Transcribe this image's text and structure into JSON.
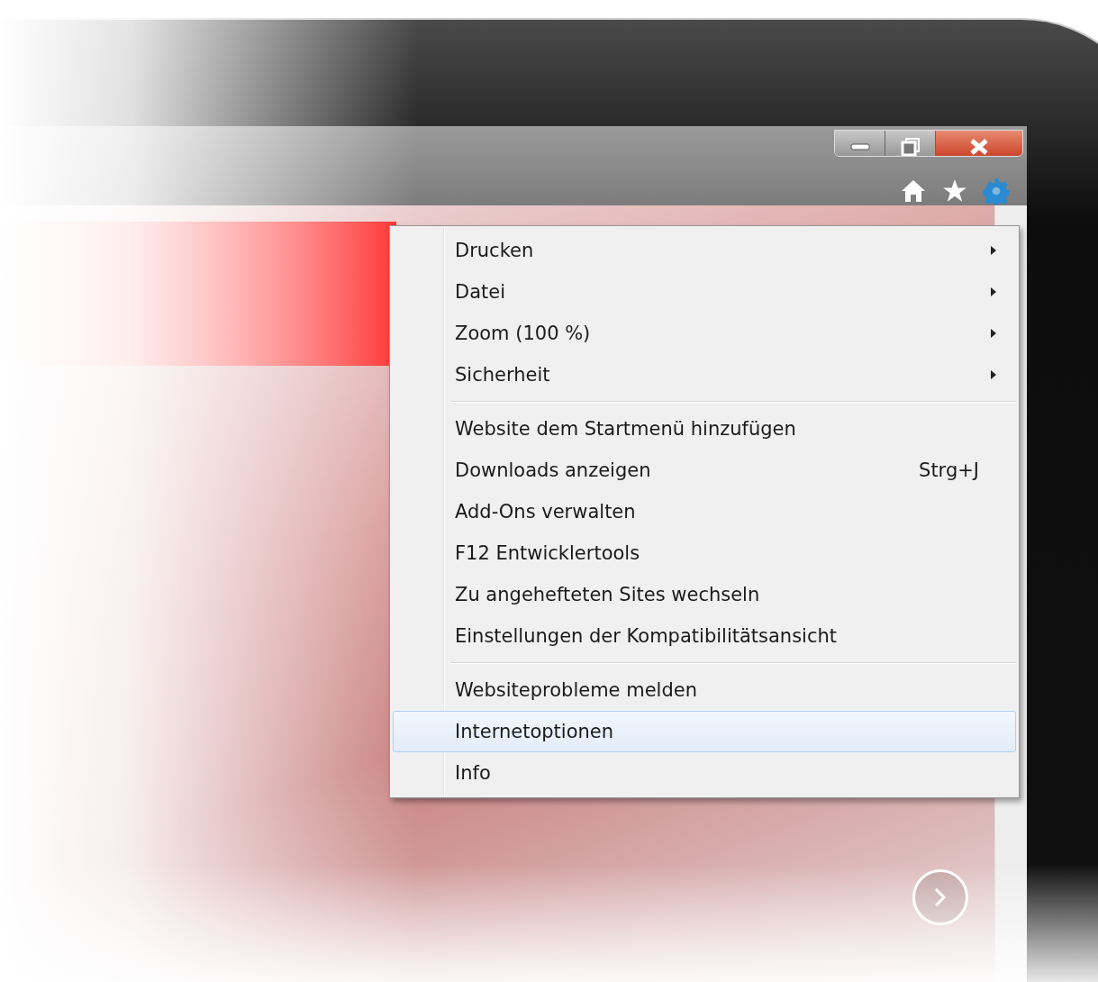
{
  "menu": {
    "groups": [
      [
        {
          "label": "Drucken",
          "submenu": true,
          "selected": false
        },
        {
          "label": "Datei",
          "submenu": true,
          "selected": false
        },
        {
          "label": "Zoom (100 %)",
          "submenu": true,
          "selected": false
        },
        {
          "label": "Sicherheit",
          "submenu": true,
          "selected": false
        }
      ],
      [
        {
          "label": "Website dem Startmenü hinzufügen",
          "submenu": false,
          "selected": false
        },
        {
          "label": "Downloads anzeigen",
          "shortcut": "Strg+J",
          "submenu": false,
          "selected": false
        },
        {
          "label": "Add-Ons verwalten",
          "submenu": false,
          "selected": false
        },
        {
          "label": "F12 Entwicklertools",
          "submenu": false,
          "selected": false
        },
        {
          "label": "Zu angehefteten Sites wechseln",
          "submenu": false,
          "selected": false
        },
        {
          "label": "Einstellungen der Kompatibilitätsansicht",
          "submenu": false,
          "selected": false
        }
      ],
      [
        {
          "label": "Websiteprobleme melden",
          "submenu": false,
          "selected": false
        },
        {
          "label": "Internetoptionen",
          "submenu": false,
          "selected": true
        },
        {
          "label": "Info",
          "submenu": false,
          "selected": false
        }
      ]
    ]
  }
}
